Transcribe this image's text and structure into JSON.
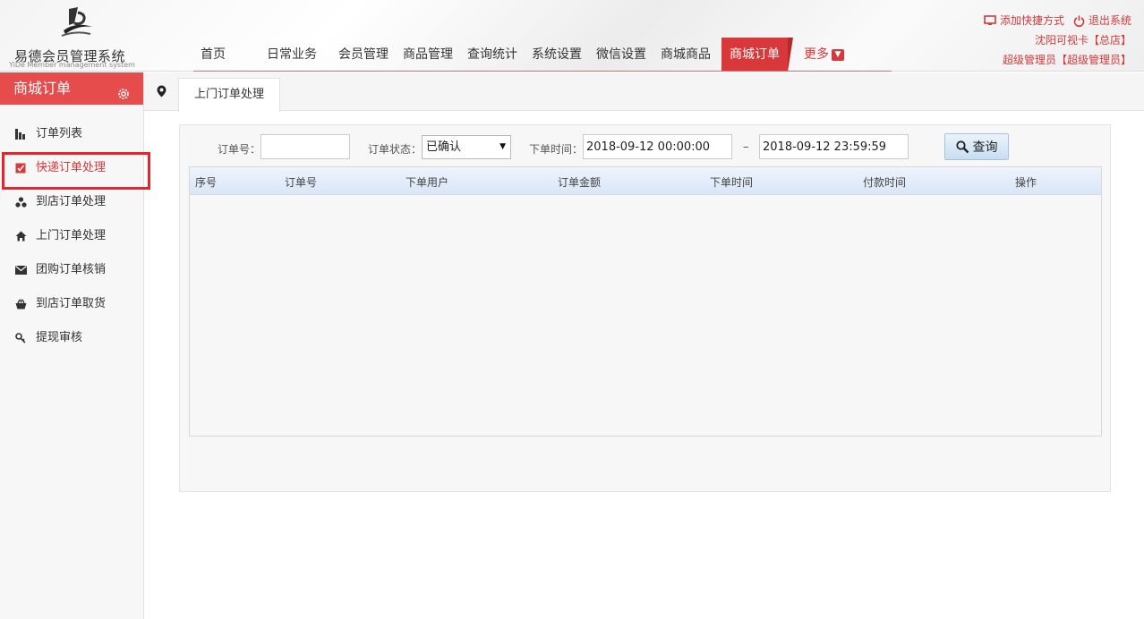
{
  "app": {
    "logo_title": "易德会员管理系统",
    "logo_subtitle": "YiDe Member management system"
  },
  "nav": {
    "items": [
      "首页",
      "日常业务",
      "会员管理",
      "商品管理",
      "查询统计",
      "系统设置",
      "微信设置",
      "商城商品"
    ],
    "active": "商城订单",
    "more": "更多"
  },
  "header_right": {
    "add_shortcut": "添加快捷方式",
    "logout": "退出系统",
    "store": "沈阳可视卡【总店】",
    "user": "超级管理员【超级管理员】"
  },
  "sidebar": {
    "title": "商城订单",
    "items": [
      {
        "label": "订单列表",
        "icon": "bar-chart-icon"
      },
      {
        "label": "快递订单处理",
        "icon": "checkbox-icon"
      },
      {
        "label": "到店订单处理",
        "icon": "cluster-icon"
      },
      {
        "label": "上门订单处理",
        "icon": "home-icon"
      },
      {
        "label": "团购订单核销",
        "icon": "envelope-icon"
      },
      {
        "label": "到店订单取货",
        "icon": "basket-icon"
      },
      {
        "label": "提现审核",
        "icon": "key-icon"
      }
    ],
    "active_index": 1
  },
  "tab": {
    "label": "上门订单处理"
  },
  "filter": {
    "order_no_label": "订单号：",
    "order_no_value": "",
    "status_label": "订单状态：",
    "status_value": "已确认",
    "time_label": "下单时间：",
    "time_start": "2018-09-12 00:00:00",
    "time_sep": "–",
    "time_end": "2018-09-12 23:59:59",
    "search_label": "查询"
  },
  "table": {
    "columns": [
      "序号",
      "订单号",
      "下单用户",
      "订单金额",
      "下单时间",
      "付款时间",
      "操作"
    ],
    "rows": []
  },
  "colors": {
    "accent": "#d9383a",
    "sidebar_head": "#e74c4c",
    "highlight_border": "#e8232a"
  }
}
